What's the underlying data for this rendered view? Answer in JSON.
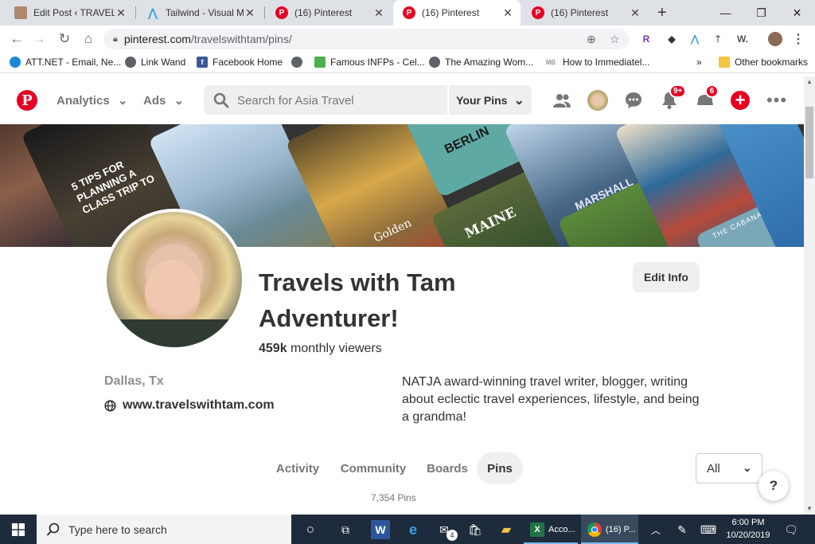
{
  "browser": {
    "tabs": [
      {
        "title": "Edit Post ‹ TRAVELS W",
        "icon": "wordpress-icon"
      },
      {
        "title": "Tailwind - Visual Ma",
        "icon": "tailwind-icon"
      },
      {
        "title": "(16) Pinterest",
        "icon": "pinterest-icon"
      },
      {
        "title": "(16) Pinterest",
        "icon": "pinterest-icon",
        "active": true
      },
      {
        "title": "(16) Pinterest",
        "icon": "pinterest-icon"
      }
    ],
    "url_host": "pinterest.com",
    "url_path": "/travelswithtam/pins/",
    "bookmarks": [
      {
        "label": "ATT.NET - Email, Ne..."
      },
      {
        "label": "Link Wand"
      },
      {
        "label": "Facebook Home"
      },
      {
        "label": ""
      },
      {
        "label": "Famous INFPs - Cel..."
      },
      {
        "label": "The Amazing Wom..."
      },
      {
        "label": "How to Immediatel..."
      }
    ],
    "bookmarks_overflow": "»",
    "other_bookmarks": "Other bookmarks"
  },
  "header": {
    "analytics": "Analytics",
    "ads": "Ads",
    "search_placeholder": "Search for Asia Travel",
    "your_pins": "Your Pins",
    "notifications_badge": "9+",
    "messages_badge": "6"
  },
  "profile": {
    "name": "Travels with Tam Adventurer!",
    "viewers_count": "459k",
    "viewers_label": "monthly viewers",
    "edit_button": "Edit Info",
    "location": "Dallas, Tx",
    "website": "www.travelswithtam.com",
    "bio": "NATJA award-winning travel writer, blogger, writing about eclectic travel experiences, lifestyle, and being a grandma!"
  },
  "profile_tabs": [
    {
      "label": "Activity"
    },
    {
      "label": "Community"
    },
    {
      "label": "Boards"
    },
    {
      "label": "Pins",
      "active": true
    }
  ],
  "filter": {
    "selected": "All"
  },
  "pin_count": "7,354 Pins",
  "help_label": "?",
  "cover_texts": [
    "5 TIPS FOR PLANNING A CLASS TRIP TO",
    "BERLIN",
    "MAINE",
    "MARSHALL",
    "Golden",
    "THE CABANA BEACH"
  ],
  "taskbar": {
    "search_placeholder": "Type here to search",
    "excel_label": "Acco...",
    "chrome_label": "(16) P...",
    "mail_badge": "4",
    "time": "6:00 PM",
    "date": "10/20/2019"
  },
  "colors": {
    "pinterest_red": "#e60023",
    "taskbar": "#1e2b3c"
  }
}
